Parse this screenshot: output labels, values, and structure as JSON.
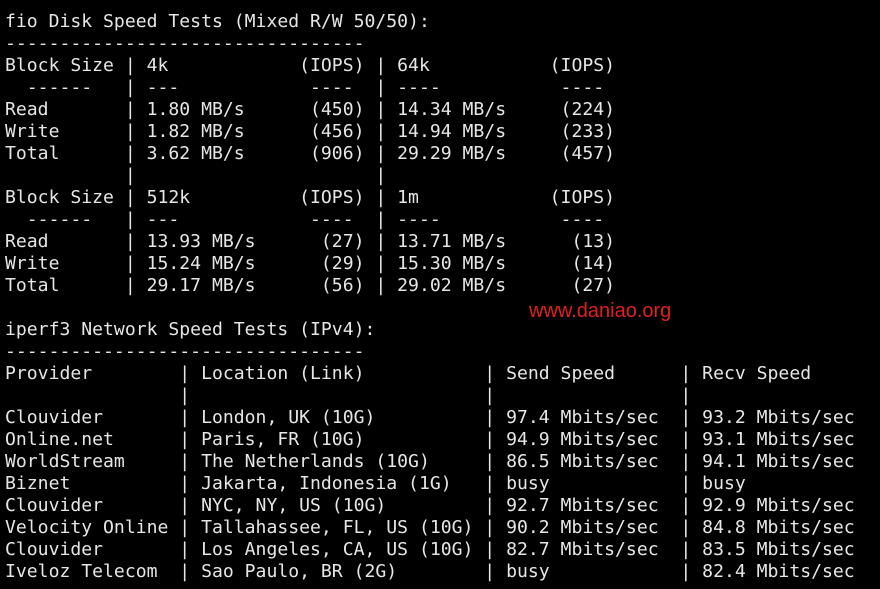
{
  "terminal": {
    "lines": [
      "",
      "fio Disk Speed Tests (Mixed R/W 50/50):",
      "---------------------------------",
      "Block Size | 4k            (IOPS) | 64k           (IOPS)",
      "  ------   | ---            ----  | ----           ----",
      "Read       | 1.80 MB/s      (450) | 14.34 MB/s     (224)",
      "Write      | 1.82 MB/s      (456) | 14.94 MB/s     (233)",
      "Total      | 3.62 MB/s      (906) | 29.29 MB/s     (457)",
      "           |                      |",
      "Block Size | 512k          (IOPS) | 1m            (IOPS)",
      "  ------   | ---            ----  | ----           ----",
      "Read       | 13.93 MB/s      (27) | 13.71 MB/s      (13)",
      "Write      | 15.24 MB/s      (29) | 15.30 MB/s      (14)",
      "Total      | 29.17 MB/s      (56) | 29.02 MB/s      (27)",
      "",
      "iperf3 Network Speed Tests (IPv4):",
      "---------------------------------",
      "Provider        | Location (Link)           | Send Speed      | Recv Speed",
      "                |                           |                 |",
      "Clouvider       | London, UK (10G)          | 97.4 Mbits/sec  | 93.2 Mbits/sec",
      "Online.net      | Paris, FR (10G)           | 94.9 Mbits/sec  | 93.1 Mbits/sec",
      "WorldStream     | The Netherlands (10G)     | 86.5 Mbits/sec  | 94.1 Mbits/sec",
      "Biznet          | Jakarta, Indonesia (1G)   | busy            | busy",
      "Clouvider       | NYC, NY, US (10G)         | 92.7 Mbits/sec  | 92.9 Mbits/sec",
      "Velocity Online | Tallahassee, FL, US (10G) | 90.2 Mbits/sec  | 84.8 Mbits/sec",
      "Clouvider       | Los Angeles, CA, US (10G) | 82.7 Mbits/sec  | 83.5 Mbits/sec",
      "Iveloz Telecom  | Sao Paulo, BR (2G)        | busy            | 82.4 Mbits/sec"
    ]
  },
  "watermark": {
    "text": "www.daniao.org",
    "color": "#e02020"
  },
  "colors": {
    "background": "#000000",
    "foreground": "#e6e6e6"
  }
}
